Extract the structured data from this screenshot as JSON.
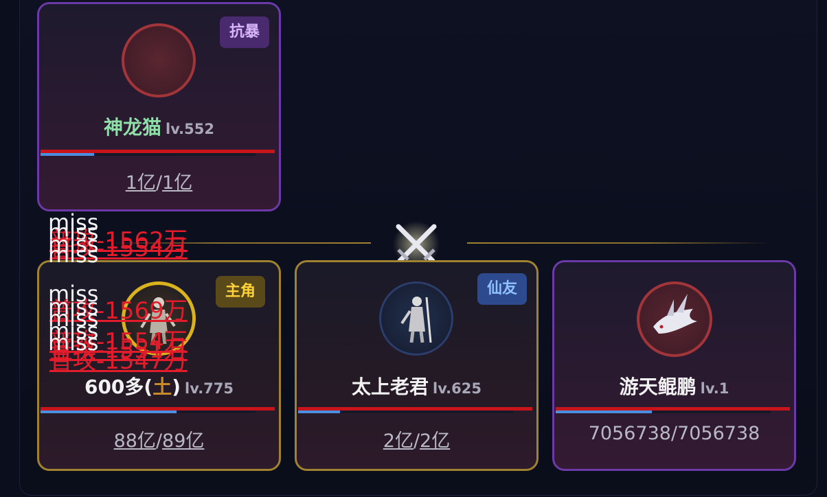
{
  "cards": {
    "enemy_top": {
      "tag": "抗暴",
      "name": "神龙猫",
      "level": "lv.552",
      "hp_current": "1亿",
      "hp_sep": "/",
      "hp_max": "1亿",
      "hp_fraction": 0.23
    },
    "player_main": {
      "tag": "主角",
      "name_prefix": "600多(",
      "name_element": "土",
      "name_suffix": ")",
      "level": "lv.775",
      "hp_current": "88亿",
      "hp_sep": "/",
      "hp_max": "89亿",
      "hp_fraction": 0.58
    },
    "ally": {
      "tag": "仙友",
      "name": "太上老君",
      "level": "lv.625",
      "hp_current": "2亿",
      "hp_sep": "/",
      "hp_max": "2亿",
      "hp_fraction": 0.18
    },
    "pet": {
      "name": "游天鲲鹏",
      "level": "lv.1",
      "hp_text": "7056738/7056738",
      "hp_fraction": 0.41
    }
  },
  "combat_text": {
    "miss": "miss",
    "dmg_1": "普攻-1562万",
    "dmg_2": "普攻-1554万",
    "dmg_3": "普攻-1569万",
    "dmg_4": "普攻-1554万",
    "dmg_5": "普攻-1547万",
    "dmg_6": "普攻-1551万"
  },
  "icons": {
    "versus": "crossed-swords-icon"
  },
  "colors": {
    "purple_border": "#6b3aa8",
    "gold_border": "#a08230",
    "hp_red": "#c8141a",
    "mp_blue": "#4a8fe0"
  }
}
